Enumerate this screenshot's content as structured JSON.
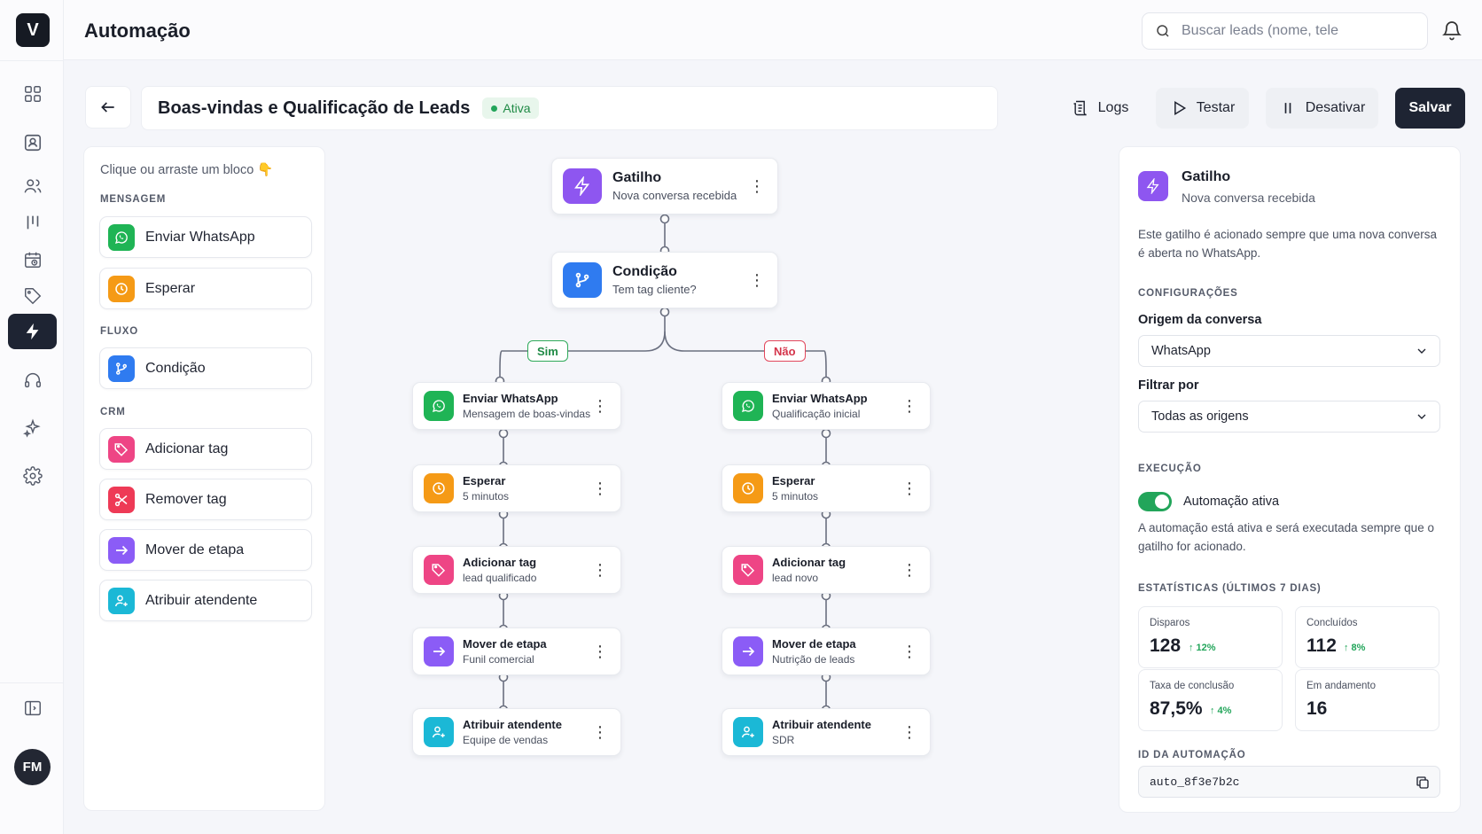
{
  "app": {
    "logo_letter": "V",
    "page_title": "Automação",
    "user_initials": "FM"
  },
  "search": {
    "placeholder": "Buscar leads (nome, tele"
  },
  "rail": {
    "items": [
      "dashboard-icon",
      "contacts-icon",
      "users-icon",
      "pipeline-icon",
      "calendar-icon",
      "tag-icon",
      "automation-icon",
      "support-icon",
      "sparkles-icon",
      "gear-icon"
    ],
    "active": "automation-icon"
  },
  "header": {
    "automation_name": "Boas-vindas e Qualificação de Leads",
    "status": "Ativa",
    "logs_label": "Logs",
    "test_label": "Testar",
    "deactivate_label": "Desativar",
    "save_label": "Salvar"
  },
  "palette": {
    "hint": "Clique ou arraste um bloco 👇",
    "sections": {
      "message": "MENSAGEM",
      "flow": "FLUXO",
      "crm": "CRM"
    },
    "blocks": {
      "send_whatsapp": "Enviar WhatsApp",
      "wait": "Esperar",
      "condition": "Condição",
      "add_tag": "Adicionar tag",
      "remove_tag": "Remover tag",
      "move_stage": "Mover de etapa",
      "assign_agent": "Atribuir atendente"
    }
  },
  "flow": {
    "trigger": {
      "title": "Gatilho",
      "sub": "Nova conversa recebida"
    },
    "condition": {
      "title": "Condição",
      "sub": "Tem tag cliente?"
    },
    "yes_label": "Sim",
    "no_label": "Não",
    "yes_branch": [
      {
        "title": "Enviar WhatsApp",
        "sub": "Mensagem de boas-vindas",
        "icon": "whatsapp-icon"
      },
      {
        "title": "Esperar",
        "sub": "5 minutos",
        "icon": "clock-icon"
      },
      {
        "title": "Adicionar tag",
        "sub": "lead qualificado",
        "icon": "tag-icon"
      },
      {
        "title": "Mover de etapa",
        "sub": "Funil comercial",
        "icon": "arrow-right-icon"
      },
      {
        "title": "Atribuir atendente",
        "sub": "Equipe de vendas",
        "icon": "user-plus-icon"
      }
    ],
    "no_branch": [
      {
        "title": "Enviar WhatsApp",
        "sub": "Qualificação inicial",
        "icon": "whatsapp-icon"
      },
      {
        "title": "Esperar",
        "sub": "5 minutos",
        "icon": "clock-icon"
      },
      {
        "title": "Adicionar tag",
        "sub": "lead novo",
        "icon": "tag-icon"
      },
      {
        "title": "Mover de etapa",
        "sub": "Nutrição de leads",
        "icon": "arrow-right-icon"
      },
      {
        "title": "Atribuir atendente",
        "sub": "SDR",
        "icon": "user-plus-icon"
      }
    ]
  },
  "props": {
    "title": "Gatilho",
    "sub": "Nova conversa recebida",
    "description": "Este gatilho é acionado sempre que uma nova conversa é aberta no WhatsApp.",
    "config_section": "CONFIGURAÇÕES",
    "origin_label": "Origem da conversa",
    "origin_value": "WhatsApp",
    "filter_label": "Filtrar por",
    "filter_value": "Todas as origens",
    "exec_section": "EXECUÇÃO",
    "toggle_label": "Automação ativa",
    "toggle_on": true,
    "exec_desc": "A automação está ativa e será executada sempre que o gatilho for acionado.",
    "stats_section": "ESTATÍSTICAS (ÚLTIMOS 7 DIAS)",
    "stats": {
      "fired_label": "Disparos",
      "fired_value": "128",
      "fired_delta": "12%",
      "done_label": "Concluídos",
      "done_value": "112",
      "done_delta": "8%",
      "rate_label": "Taxa de conclusão",
      "rate_value": "87,5%",
      "rate_delta": "4%",
      "running_label": "Em andamento",
      "running_value": "16"
    },
    "id_section": "ID DA AUTOMAÇÃO",
    "id_value": "auto_8f3e7b2c"
  },
  "colors": {
    "whatsapp": "#1fb455",
    "wait": "#f59a16",
    "condition": "#2f7bf0",
    "tag": "#ee4585",
    "remove": "#ee3a56",
    "move": "#8b5cf6",
    "assign": "#1bb8d6",
    "trigger": "#8e56f0",
    "active_green": "#22a55a",
    "dark": "#1e2433"
  }
}
